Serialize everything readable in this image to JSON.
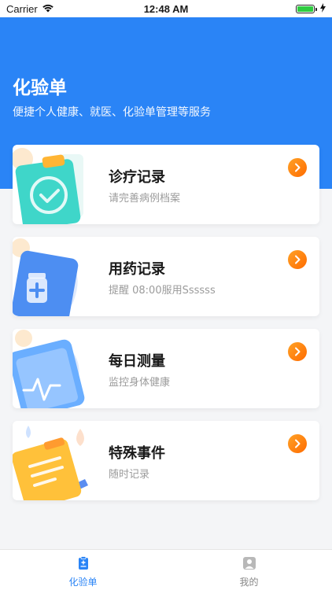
{
  "status_bar": {
    "carrier": "Carrier",
    "time": "12:48 AM"
  },
  "header": {
    "title": "化验单",
    "subtitle": "便捷个人健康、就医、化验单管理等服务",
    "background_color": "#2a84f6"
  },
  "cards": [
    {
      "title": "诊疗记录",
      "subtitle": "请完善病例档案",
      "icon": "clipboard-check-icon"
    },
    {
      "title": "用药记录",
      "subtitle": "提醒 08:00服用Ssssss",
      "icon": "medicine-bottle-icon"
    },
    {
      "title": "每日测量",
      "subtitle": "监控身体健康",
      "icon": "phone-heartbeat-icon"
    },
    {
      "title": "特殊事件",
      "subtitle": "随时记录",
      "icon": "notepad-pen-icon"
    }
  ],
  "tabbar": {
    "items": [
      {
        "label": "化验单",
        "icon": "report-icon",
        "active": true
      },
      {
        "label": "我的",
        "icon": "person-icon",
        "active": false
      }
    ],
    "active_color": "#2a84f6"
  }
}
